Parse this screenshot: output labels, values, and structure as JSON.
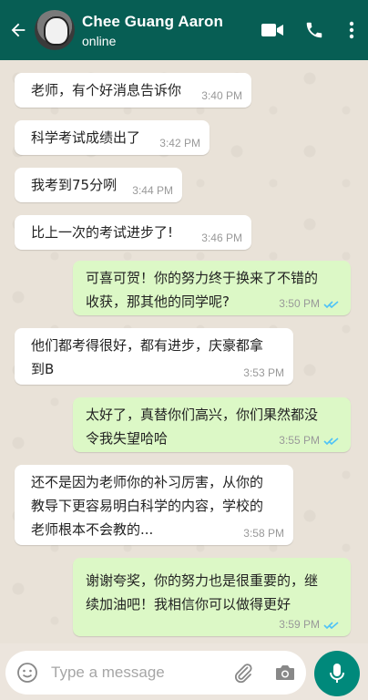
{
  "header": {
    "contact_name": "Chee Guang Aaron",
    "status": "online",
    "icons": [
      "back-arrow-icon",
      "video-call-icon",
      "phone-icon",
      "more-vertical-icon"
    ]
  },
  "messages": [
    {
      "direction": "in",
      "text_lines": [
        "老师，有个好消息告诉你"
      ],
      "time": "3:40 PM"
    },
    {
      "direction": "in",
      "text_lines": [
        "科学考试成绩出了"
      ],
      "time": "3:42 PM"
    },
    {
      "direction": "in",
      "text_lines": [
        "我考到75分咧"
      ],
      "time": "3:44 PM"
    },
    {
      "direction": "in",
      "text_lines": [
        "比上一次的考试进步了!"
      ],
      "time": "3:46 PM"
    },
    {
      "direction": "out",
      "text_lines": [
        "可喜可贺！你的努力终于换来了不错的",
        "收获，那其他的同学呢?"
      ],
      "time": "3:50 PM",
      "read": true
    },
    {
      "direction": "in",
      "text_lines": [
        "他们都考得很好，都有进步，庆豪都拿",
        "到B"
      ],
      "time": "3:53 PM"
    },
    {
      "direction": "out",
      "text_lines": [
        "太好了，真替你们高兴，你们果然都没",
        "令我失望哈哈"
      ],
      "time": "3:55 PM",
      "read": true
    },
    {
      "direction": "in",
      "text_lines": [
        "还不是因为老师你的补习厉害，从你的",
        "教导下更容易明白科学的内容，学校的",
        "老师根本不会教的..."
      ],
      "time": "3:58 PM"
    },
    {
      "direction": "out",
      "text_lines": [
        "谢谢夸奖，你的努力也是很重要的，继",
        "续加油吧！我相信你可以做得更好"
      ],
      "time": "3:59 PM",
      "read": true
    }
  ],
  "input": {
    "placeholder": "Type a message",
    "icons": [
      "emoji-icon",
      "attach-icon",
      "camera-icon",
      "mic-icon"
    ]
  },
  "colors": {
    "header": "#075e54",
    "outgoing_bubble": "#dcf8c6",
    "incoming_bubble": "#ffffff",
    "read_ticks": "#4fc3f7",
    "mic_button": "#00897b"
  }
}
